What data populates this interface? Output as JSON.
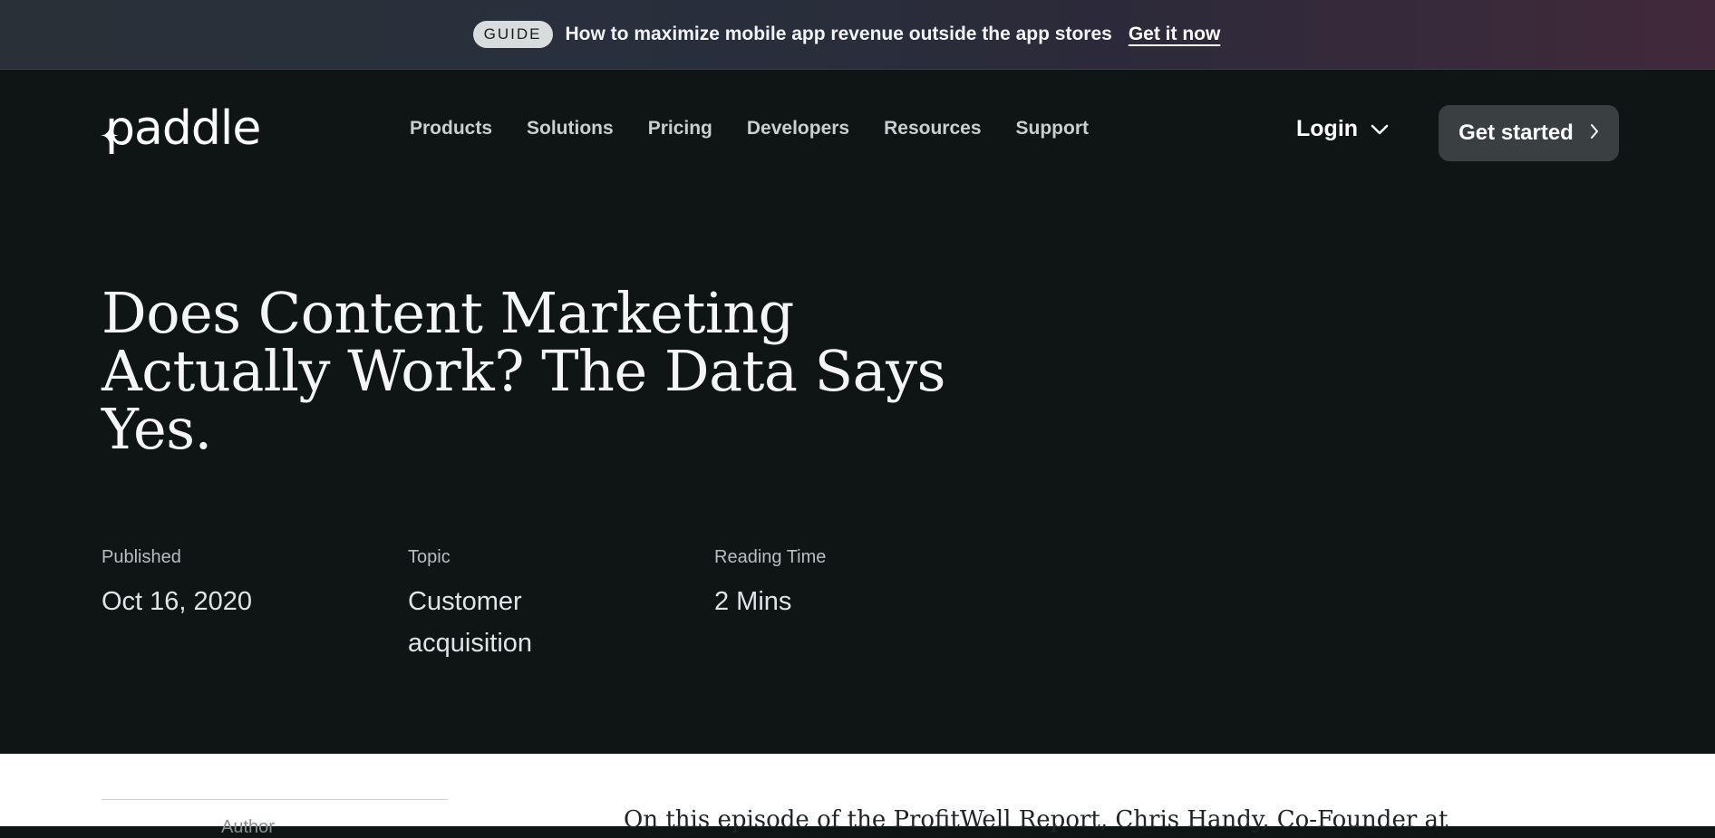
{
  "banner": {
    "pill": "GUIDE",
    "text": "How to maximize mobile app revenue outside the app stores",
    "link": "Get it now"
  },
  "header": {
    "logo": "paddle",
    "nav": [
      "Products",
      "Solutions",
      "Pricing",
      "Developers",
      "Resources",
      "Support"
    ],
    "login": "Login",
    "cta": "Get started"
  },
  "article": {
    "title": "Does Content Marketing Actually Work? The Data Says Yes.",
    "meta": [
      {
        "label": "Published",
        "value": "Oct 16, 2020"
      },
      {
        "label": "Topic",
        "value": "Customer acquisition"
      },
      {
        "label": "Reading Time",
        "value": "2 Mins"
      }
    ],
    "author_label": "Author",
    "intro": "On this episode of the ProfitWell Report, Chris Handy, Co-Founder at"
  },
  "colors": {
    "background": "#0f1414",
    "cta_background": "#3a3f41",
    "content_background": "#ffffff"
  }
}
